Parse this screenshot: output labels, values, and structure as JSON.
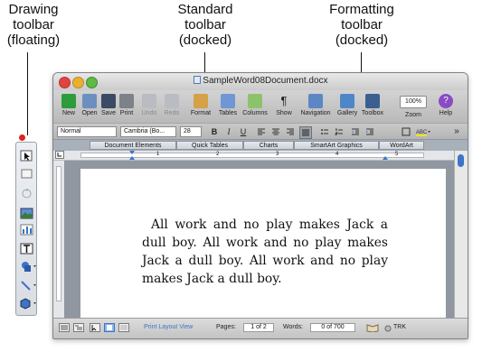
{
  "callouts": {
    "drawing": [
      "Drawing",
      "toolbar",
      "(floating)"
    ],
    "standard": [
      "Standard",
      "toolbar",
      "(docked)"
    ],
    "formatting": [
      "Formatting",
      "toolbar",
      "(docked)"
    ]
  },
  "window": {
    "title": "SampleWord08Document.docx"
  },
  "standard_toolbar": {
    "buttons": [
      "New",
      "Open",
      "Save",
      "Print",
      "Undo",
      "Redo",
      "Format",
      "Tables",
      "Columns",
      "Show",
      "Navigation",
      "Gallery",
      "Toolbox",
      "Zoom",
      "Help"
    ],
    "zoom_value": "100%"
  },
  "formatting_toolbar": {
    "style": "Normal",
    "font": "Cambria (Bo...",
    "size": "28",
    "bold": "B",
    "italic": "I",
    "underline": "U"
  },
  "gallery_tabs": [
    "Document Elements",
    "Quick Tables",
    "Charts",
    "SmartArt Graphics",
    "WordArt"
  ],
  "ruler_numbers": [
    "1",
    "2",
    "3",
    "4",
    "5"
  ],
  "document": {
    "text": "All work and no play makes Jack a dull boy. All work and no play makes Jack a dull boy. All work and no play makes Jack a dull boy."
  },
  "status": {
    "view": "Print Layout View",
    "pages_label": "Pages:",
    "pages_value": "1 of 2",
    "words_label": "Words:",
    "words_value": "0 of 700",
    "trk": "TRK"
  },
  "colors": {
    "close": "#e0443e",
    "minimize": "#e9b12b",
    "zoom": "#5fb944",
    "accent": "#3b74c9"
  }
}
